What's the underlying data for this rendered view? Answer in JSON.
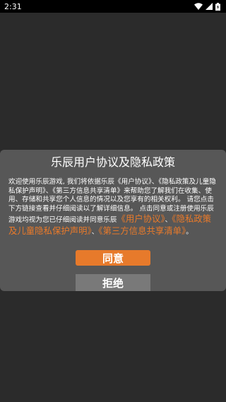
{
  "status_bar": {
    "time": "2:31"
  },
  "dialog": {
    "title": "乐辰用户协议及隐私政策",
    "body_text": "欢迎使用乐辰游戏, 我们将依据乐辰《用户协议》、《隐私政策及儿童隐私保护声明》、《第三方信息共享清单》来帮助您了解我们在收集、使用、存储和共享您个人信息的情况以及您享有的相关权利。 请您点击下方链接查看并仔细阅读以了解详细信息。 点击同意或注册使用乐辰游戏均视为您已仔细阅读并同意乐辰",
    "link_user_agreement": "《用户协议》",
    "separator_1": "、",
    "link_privacy_policy": "《隐私政策及儿童隐私保护声明》",
    "separator_2": "、",
    "link_third_party": "《第三方信息共享清单》",
    "end_punct": "。",
    "agree_label": "同意",
    "refuse_label": "拒绝"
  },
  "colors": {
    "accent": "#e77a2b",
    "dialog_bg": "#575757",
    "screen_bg": "#2b2b2b",
    "refuse_bg": "#797979"
  }
}
